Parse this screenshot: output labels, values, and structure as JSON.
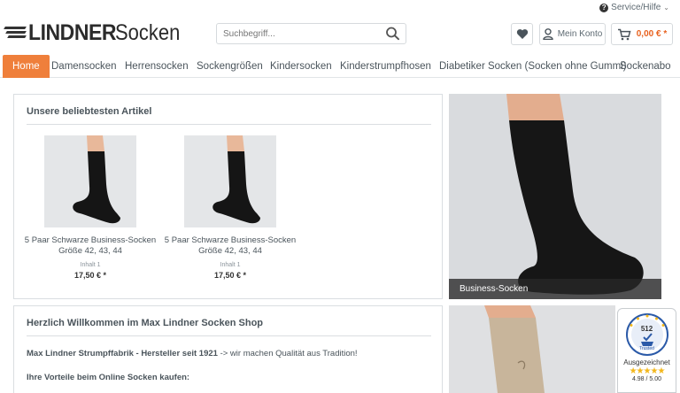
{
  "topbar": {
    "service_label": "Service/Hilfe"
  },
  "logo": {
    "brand_bold": "LINDNER",
    "brand_regular": "Socken"
  },
  "search": {
    "placeholder": "Suchbegriff..."
  },
  "header": {
    "account_label": "Mein Konto",
    "cart_total": "0,00 € *"
  },
  "nav": {
    "items": [
      {
        "label": "Home",
        "active": true
      },
      {
        "label": "Damensocken"
      },
      {
        "label": "Herrensocken"
      },
      {
        "label": "Sockengrößen"
      },
      {
        "label": "Kindersocken"
      },
      {
        "label": "Kinderstrumpfhosen"
      },
      {
        "label": "Diabetiker Socken (Socken ohne Gummi)"
      },
      {
        "label": "Sockenabo"
      }
    ]
  },
  "popular": {
    "title": "Unsere beliebtesten Artikel",
    "products": [
      {
        "name_line1": "5 Paar Schwarze Business-Socken",
        "name_line2": "Größe 42, 43, 44",
        "content_label": "Inhalt 1",
        "price": "17,50 € *"
      },
      {
        "name_line1": "5 Paar Schwarze Business-Socken",
        "name_line2": "Größe 42, 43, 44",
        "content_label": "Inhalt 1",
        "price": "17,50 € *"
      }
    ]
  },
  "banners": [
    {
      "caption": "Business-Socken"
    }
  ],
  "welcome": {
    "title": "Herzlich Willkommen im Max Lindner Socken Shop",
    "line1_bold": "Max Lindner Strumpffabrik - Hersteller seit 1921",
    "line1_rest": " -> wir machen Qualität aus Tradition!",
    "line2": "Ihre Vorteile beim Online Socken kaufen:"
  },
  "trust_badge": {
    "review_count": "512",
    "seal_label": "Trusted",
    "label": "Ausgezeichnet",
    "stars": "★★★★★",
    "score": "4.98 / 5.00"
  },
  "colors": {
    "accent": "#ef7f3b",
    "cart_text": "#e8621f",
    "text": "#4a545b"
  }
}
